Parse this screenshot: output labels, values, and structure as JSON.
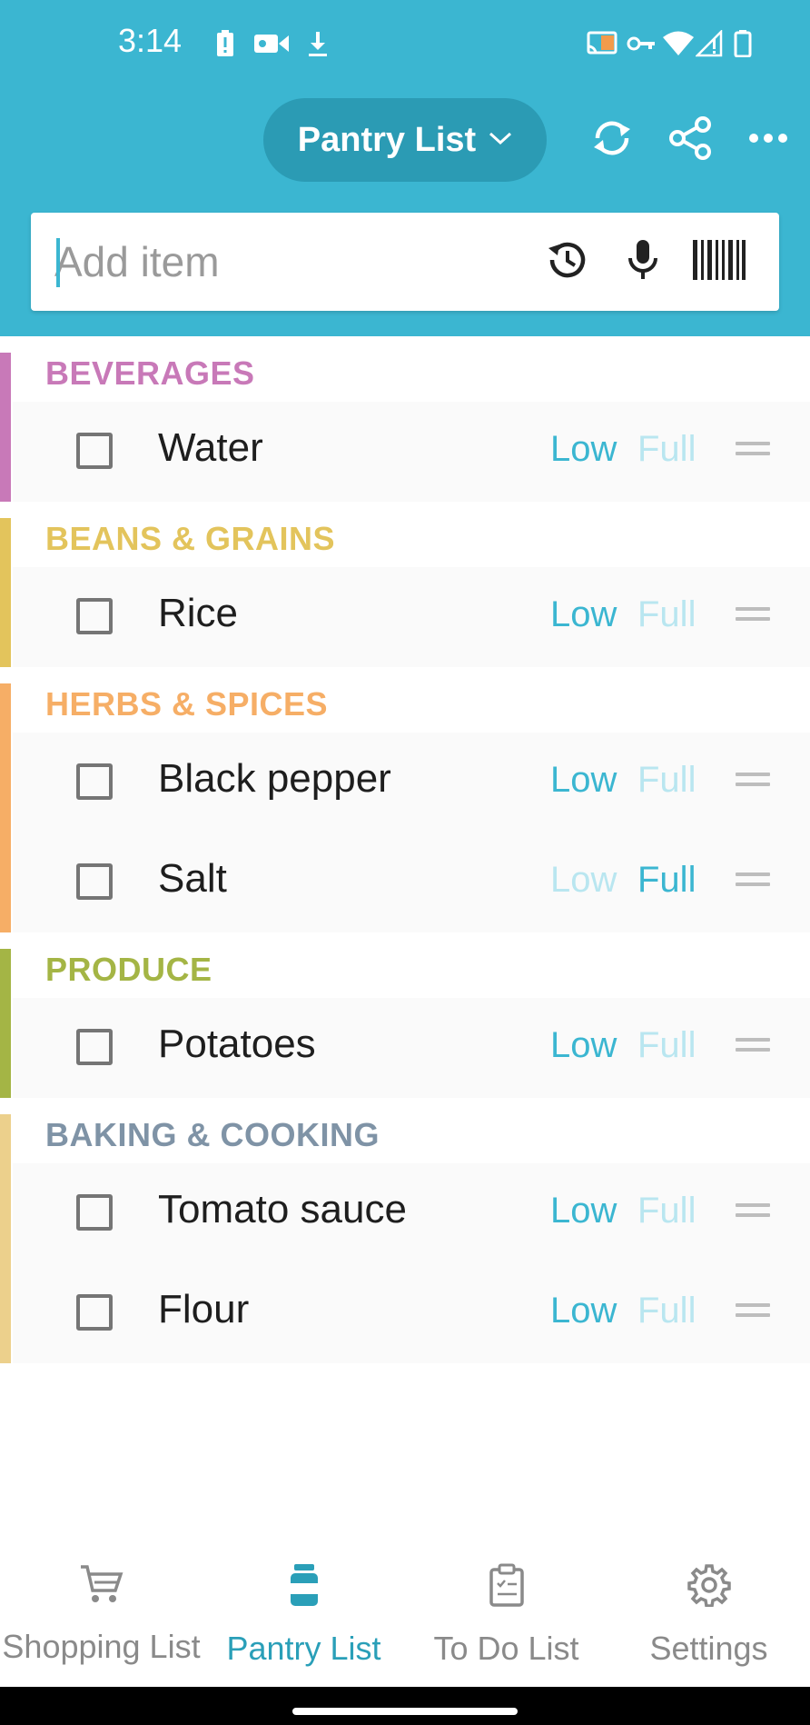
{
  "status_bar": {
    "time": "3:14"
  },
  "header": {
    "list_selector_label": "Pantry List",
    "chevron": "chevron-down-icon",
    "sync_icon": "sync-icon",
    "share_icon": "share-icon",
    "more_icon": "more-icon"
  },
  "add_item": {
    "placeholder": "Add item",
    "icons": [
      "history-icon",
      "mic-icon",
      "barcode-icon"
    ]
  },
  "categories": [
    {
      "title": "BEVERAGES",
      "color": "#c879b8",
      "items": [
        {
          "name": "Water",
          "low_label": "Low",
          "full_label": "Full",
          "level": "Low"
        }
      ]
    },
    {
      "title": "BEANS & GRAINS",
      "color": "#e3c45c",
      "items": [
        {
          "name": "Rice",
          "low_label": "Low",
          "full_label": "Full",
          "level": "Low"
        }
      ]
    },
    {
      "title": "HERBS & SPICES",
      "color": "#f6ae66",
      "items": [
        {
          "name": "Black pepper",
          "low_label": "Low",
          "full_label": "Full",
          "level": "Low"
        },
        {
          "name": "Salt",
          "low_label": "Low",
          "full_label": "Full",
          "level": "Full"
        }
      ]
    },
    {
      "title": "PRODUCE",
      "color": "#a4b545",
      "items": [
        {
          "name": "Potatoes",
          "low_label": "Low",
          "full_label": "Full",
          "level": "Low"
        }
      ]
    },
    {
      "title": "BAKING & COOKING",
      "color": "#7f93a6",
      "bar_color": "#ecd08c",
      "items": [
        {
          "name": "Tomato sauce",
          "low_label": "Low",
          "full_label": "Full",
          "level": "Low"
        },
        {
          "name": "Flour",
          "low_label": "Low",
          "full_label": "Full",
          "level": "Low"
        }
      ]
    }
  ],
  "bottom_nav": [
    {
      "label": "Shopping List",
      "icon": "cart-icon",
      "active": false
    },
    {
      "label": "Pantry List",
      "icon": "jar-icon",
      "active": true
    },
    {
      "label": "To Do List",
      "icon": "clipboard-icon",
      "active": false
    },
    {
      "label": "Settings",
      "icon": "gear-icon",
      "active": false
    }
  ],
  "colors": {
    "accent": "#3bb6d1",
    "pill": "#2b9bb4",
    "active_nav": "#2a9fb8",
    "level_on": "#3bb6d1",
    "level_off": "#b9e6f0"
  }
}
